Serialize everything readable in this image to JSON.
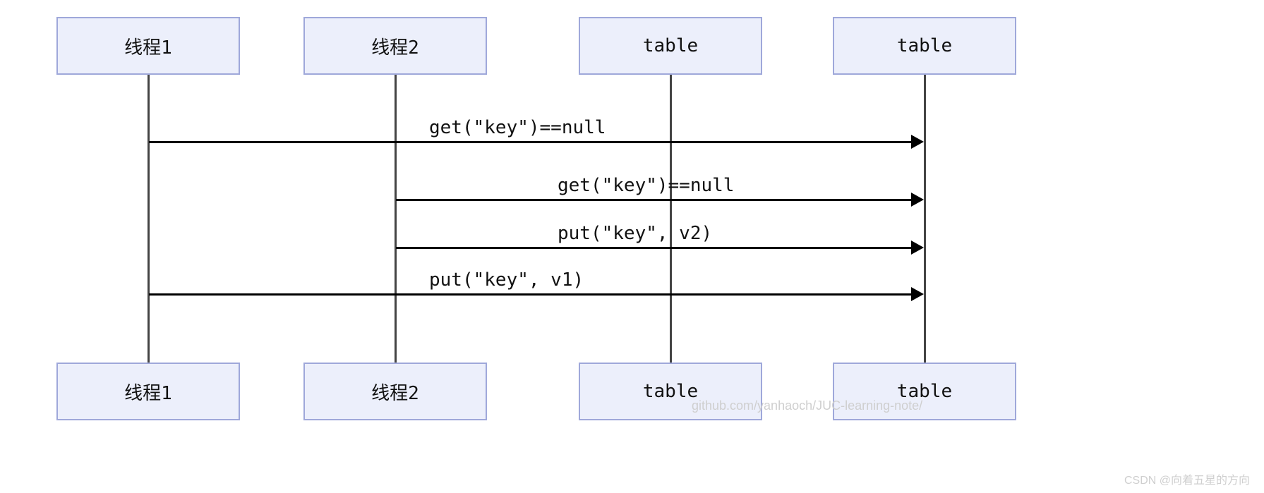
{
  "participants": {
    "p1": "线程1",
    "p2": "线程2",
    "p3": "table",
    "p4": "table"
  },
  "messages": {
    "m1": "get(\"key\")==null",
    "m2": "get(\"key\")==null",
    "m3": "put(\"key\", v2)",
    "m4": "put(\"key\", v1)"
  },
  "watermarks": {
    "repo": "github.com/yanhaoch/JUC-learning-note/",
    "csdn": "CSDN @向着五星的方向"
  },
  "chart_data": {
    "type": "sequence-diagram",
    "participants": [
      "线程1",
      "线程2",
      "table",
      "table"
    ],
    "interactions": [
      {
        "from": "线程1",
        "to": "table(4)",
        "label": "get(\"key\")==null"
      },
      {
        "from": "线程2",
        "to": "table(4)",
        "label": "get(\"key\")==null"
      },
      {
        "from": "线程2",
        "to": "table(4)",
        "label": "put(\"key\", v2)"
      },
      {
        "from": "线程1",
        "to": "table(4)",
        "label": "put(\"key\", v1)"
      }
    ]
  }
}
